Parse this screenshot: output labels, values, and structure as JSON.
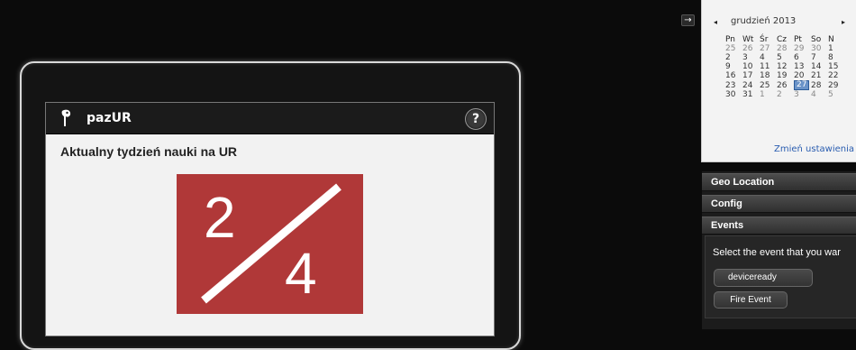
{
  "app": {
    "title": "pazUR",
    "help_label": "?",
    "heading": "Aktualny tydzień nauki na UR",
    "week_current": "2",
    "week_total": "4"
  },
  "collapse": {
    "label": "→"
  },
  "calendar": {
    "prev": "◂",
    "next": "▸",
    "month_label": "grudzień 2013",
    "weekdays": [
      "Pn",
      "Wt",
      "Śr",
      "Cz",
      "Pt",
      "So",
      "N"
    ],
    "weeks": [
      [
        {
          "d": "25",
          "o": true
        },
        {
          "d": "26",
          "o": true
        },
        {
          "d": "27",
          "o": true
        },
        {
          "d": "28",
          "o": true
        },
        {
          "d": "29",
          "o": true
        },
        {
          "d": "30",
          "o": true
        },
        {
          "d": "1"
        }
      ],
      [
        {
          "d": "2"
        },
        {
          "d": "3"
        },
        {
          "d": "4"
        },
        {
          "d": "5"
        },
        {
          "d": "6"
        },
        {
          "d": "7"
        },
        {
          "d": "8"
        }
      ],
      [
        {
          "d": "9"
        },
        {
          "d": "10"
        },
        {
          "d": "11"
        },
        {
          "d": "12"
        },
        {
          "d": "13"
        },
        {
          "d": "14"
        },
        {
          "d": "15"
        }
      ],
      [
        {
          "d": "16"
        },
        {
          "d": "17"
        },
        {
          "d": "18"
        },
        {
          "d": "19"
        },
        {
          "d": "20"
        },
        {
          "d": "21"
        },
        {
          "d": "22"
        }
      ],
      [
        {
          "d": "23"
        },
        {
          "d": "24"
        },
        {
          "d": "25"
        },
        {
          "d": "26"
        },
        {
          "d": "27",
          "today": true
        },
        {
          "d": "28"
        },
        {
          "d": "29"
        }
      ],
      [
        {
          "d": "30"
        },
        {
          "d": "31"
        },
        {
          "d": "1",
          "o": true
        },
        {
          "d": "2",
          "o": true
        },
        {
          "d": "3",
          "o": true
        },
        {
          "d": "4",
          "o": true
        },
        {
          "d": "5",
          "o": true
        }
      ]
    ],
    "settings_link": "Zmień ustawienia"
  },
  "panel": {
    "geo_label": "Geo Location",
    "config_label": "Config",
    "events_label": "Events",
    "events_text": "Select the event that you war",
    "event_select": "deviceready",
    "fire_label": "Fire Event"
  },
  "colors": {
    "week_box": "#b03838",
    "today": "#6a93c8",
    "link": "#2a5db0"
  }
}
